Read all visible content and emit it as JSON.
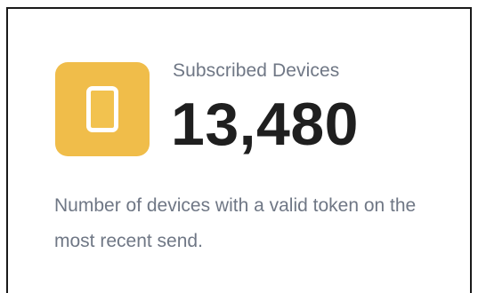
{
  "card": {
    "icon": "phone-icon",
    "accent_color": "#f0bd4a",
    "label": "Subscribed Devices",
    "value": "13,480",
    "description": "Number of devices with a valid token on the most recent send."
  }
}
